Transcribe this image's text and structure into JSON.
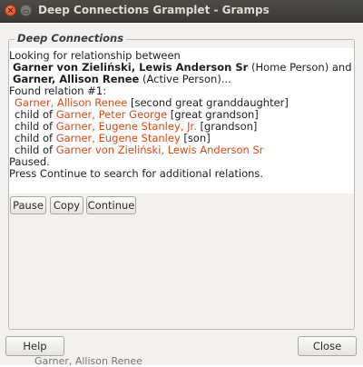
{
  "window": {
    "title": "Deep Connections Gramplet - Gramps"
  },
  "frame": {
    "label": "Deep Connections"
  },
  "text": {
    "l1": "Looking for relationship between",
    "l2_name": "Garner von Zieliński, Lewis Anderson Sr",
    "l2_rest": " (Home Person) and",
    "l3_name": "Garner, Allison Renee",
    "l3_rest": " (Active Person)...",
    "l4": "Found relation #1:",
    "r1_link": "Garner, Allison Renee",
    "r1_rest": " [second great granddaughter]",
    "r2_pre": "child of ",
    "r2_link": "Garner, Peter George",
    "r2_rest": " [great grandson]",
    "r3_pre": "child of ",
    "r3_link": "Garner, Eugene Stanley, Jr.",
    "r3_rest": " [grandson]",
    "r4_pre": "child of ",
    "r4_link": "Garner, Eugene Stanley",
    "r4_rest": " [son]",
    "r5_pre": "child of ",
    "r5_link": "Garner von Zieliński, Lewis Anderson Sr",
    "l10": "Paused.",
    "l11": "Press Continue to search for additional relations."
  },
  "buttons": {
    "pause": "Pause",
    "copy": "Copy",
    "continue": "Continue",
    "help": "Help",
    "close": "Close"
  },
  "background_text": "Garner, Allison Renee",
  "colors": {
    "link": "#dd4814",
    "titlebar": "#3b3a36",
    "dialog_bg": "#f2f1f0"
  }
}
